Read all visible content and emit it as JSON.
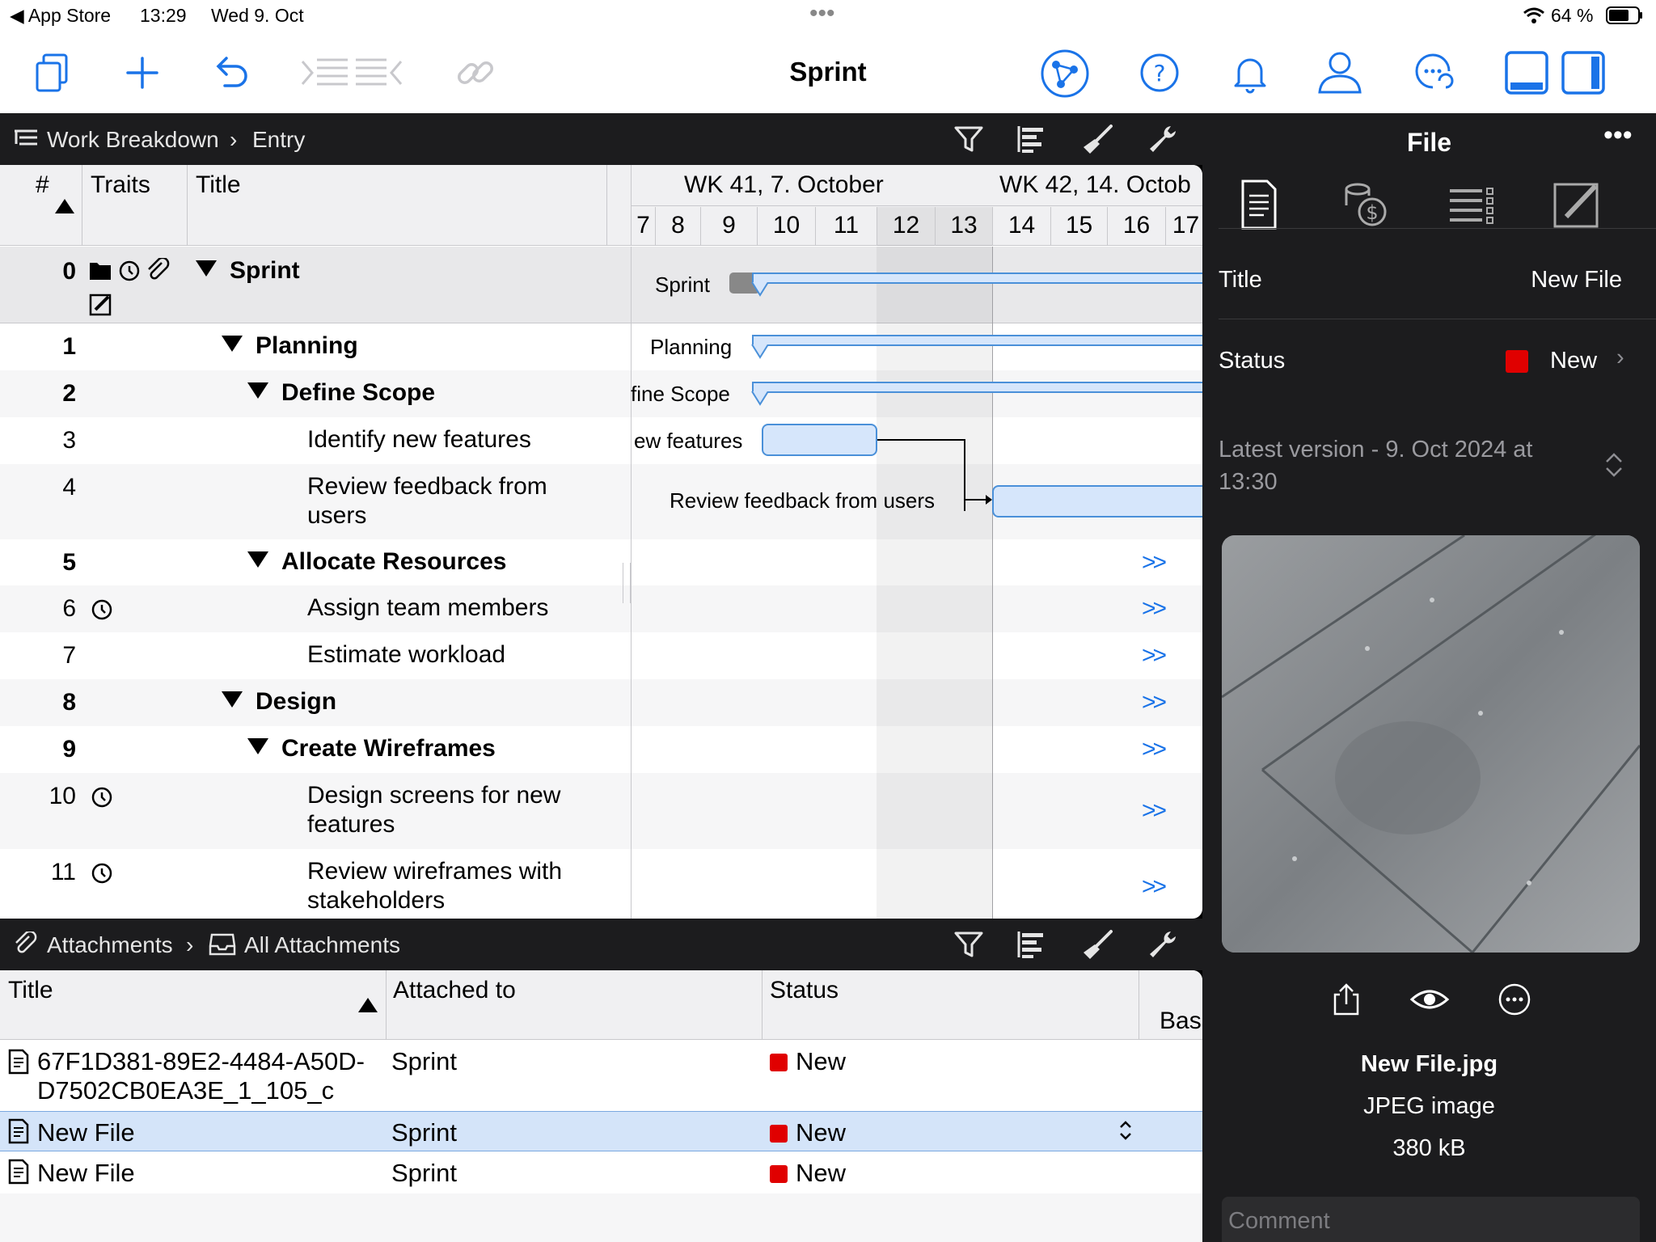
{
  "status_bar": {
    "back_app": "App Store",
    "time": "13:29",
    "date": "Wed 9. Oct",
    "battery": "64 %"
  },
  "toolbar": {
    "title": "Sprint",
    "icons": [
      "documents-icon",
      "add-icon",
      "undo-icon",
      "outdent-indent-icon",
      "link-icon",
      "network-icon",
      "help-icon",
      "bell-icon",
      "person-icon",
      "sync-icon",
      "bottom-panel-icon",
      "side-panel-icon"
    ]
  },
  "wbs": {
    "breadcrumb_root": "Work Breakdown",
    "breadcrumb_leaf": "Entry",
    "columns": {
      "num": "#",
      "traits": "Traits",
      "title": "Title"
    },
    "weeks": [
      "WK 41, 7. October",
      "WK 42, 14. Octob"
    ],
    "days": [
      "7",
      "8",
      "9",
      "10",
      "11",
      "12",
      "13",
      "14",
      "15",
      "16",
      "17"
    ],
    "rows": [
      {
        "num": "0",
        "title": "Sprint",
        "gantt": "Sprint"
      },
      {
        "num": "1",
        "title": "Planning",
        "gantt": "Planning"
      },
      {
        "num": "2",
        "title": "Define Scope",
        "gantt": "fine Scope"
      },
      {
        "num": "3",
        "title": "Identify new features",
        "gantt": "ew features"
      },
      {
        "num": "4",
        "title": "Review feedback from users",
        "gantt": "Review feedback from users"
      },
      {
        "num": "5",
        "title": "Allocate Resources",
        "more": ">>"
      },
      {
        "num": "6",
        "title": "Assign team members",
        "more": ">>"
      },
      {
        "num": "7",
        "title": "Estimate workload",
        "more": ">>"
      },
      {
        "num": "8",
        "title": "Design",
        "more": ">>"
      },
      {
        "num": "9",
        "title": "Create Wireframes",
        "more": ">>"
      },
      {
        "num": "10",
        "title": "Design screens for new features",
        "more": ">>"
      },
      {
        "num": "11",
        "title": "Review wireframes with stakeholders",
        "more": ">>"
      }
    ]
  },
  "attachments": {
    "breadcrumb_root": "Attachments",
    "breadcrumb_leaf": "All Attachments",
    "columns": {
      "title": "Title",
      "attached_to": "Attached to",
      "status": "Status",
      "base": "Bas"
    },
    "rows": [
      {
        "title": "67F1D381-89E2-4484-A50D-D7502CB0EA3E_1_105_c",
        "attached_to": "Sprint",
        "status": "New"
      },
      {
        "title": "New File",
        "attached_to": "Sprint",
        "status": "New"
      },
      {
        "title": "New File",
        "attached_to": "Sprint",
        "status": "New"
      }
    ]
  },
  "inspector": {
    "header": "File",
    "title_label": "Title",
    "title_value": "New File",
    "status_label": "Status",
    "status_value": "New",
    "version": "Latest version - 9. Oct 2024 at 13:30",
    "file_name": "New File.jpg",
    "file_type": "JPEG image",
    "file_size": "380 kB",
    "comment_placeholder": "Comment",
    "status_color": "#e00000",
    "accent": "#1a73e8"
  }
}
